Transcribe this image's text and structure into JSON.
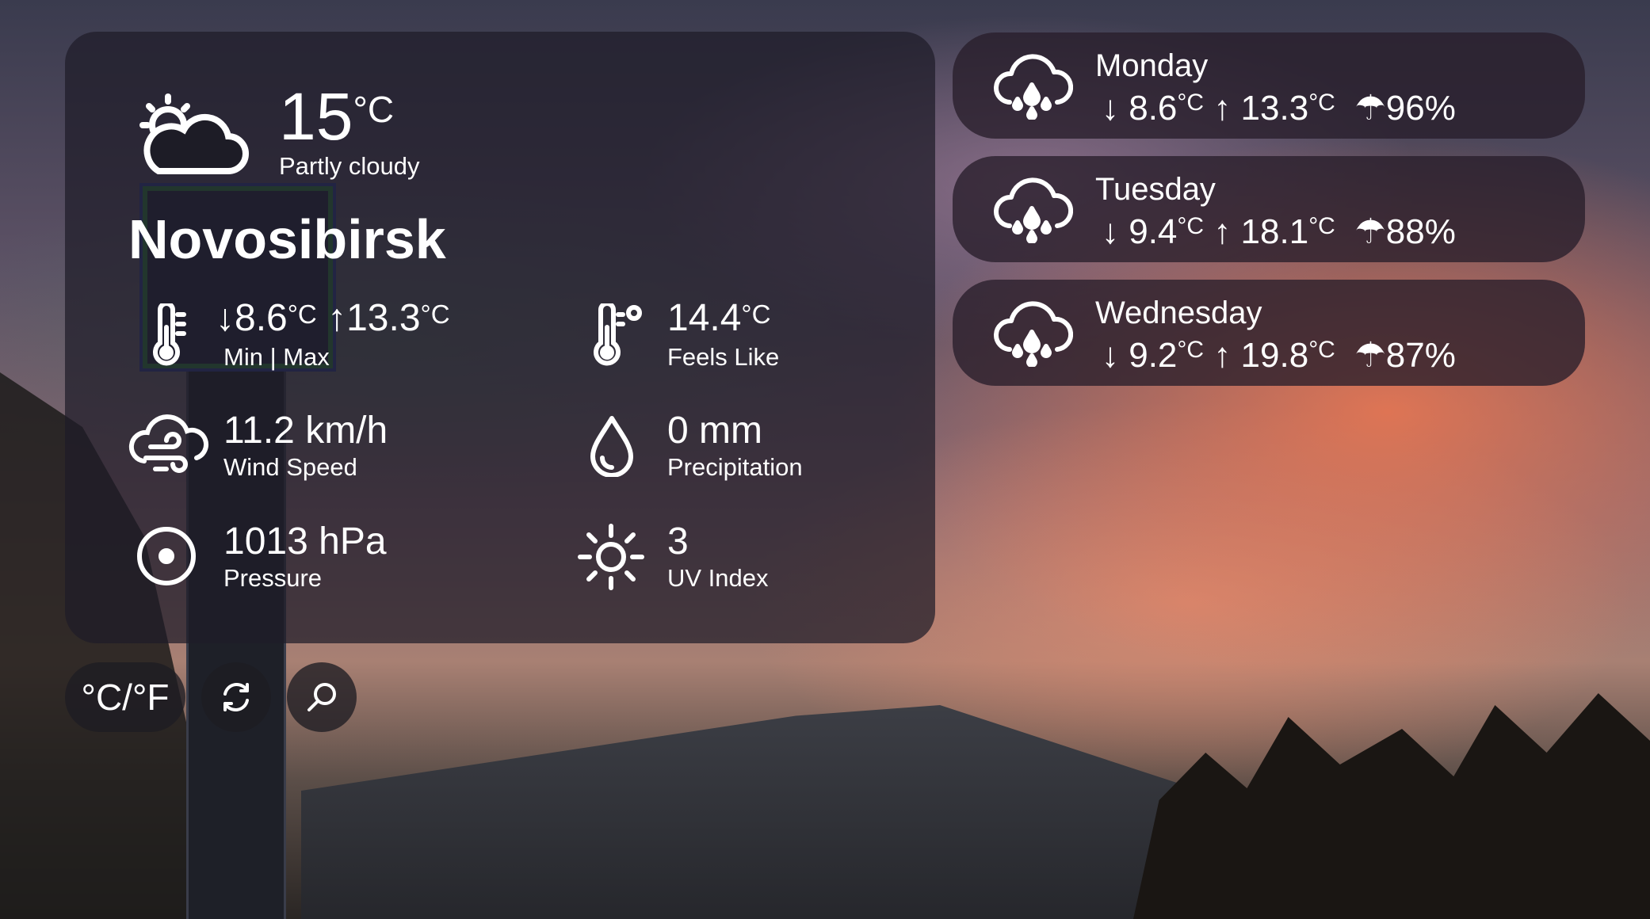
{
  "current": {
    "temperature": "15",
    "temperature_unit": "°C",
    "condition": "Partly cloudy",
    "city": "Novosibirsk"
  },
  "details": {
    "min": "8.6",
    "min_unit": "°C",
    "max": "13.3",
    "max_unit": "°C",
    "minmax_label": "Min | Max",
    "feels_like": "14.4",
    "feels_like_unit": "°C",
    "feels_like_label": "Feels Like",
    "wind": "11.2 km/h",
    "wind_label": "Wind Speed",
    "precipitation": "0 mm",
    "precipitation_label": "Precipitation",
    "pressure": "1013 hPa",
    "pressure_label": "Pressure",
    "uv": "3",
    "uv_label": "UV Index"
  },
  "forecast": [
    {
      "day": "Monday",
      "min": "8.6",
      "max": "13.3",
      "unit": "°C",
      "rain": "96%",
      "icon": "cloud-rain-icon"
    },
    {
      "day": "Tuesday",
      "min": "9.4",
      "max": "18.1",
      "unit": "°C",
      "rain": "88%",
      "icon": "cloud-rain-icon"
    },
    {
      "day": "Wednesday",
      "min": "9.2",
      "max": "19.8",
      "unit": "°C",
      "rain": "87%",
      "icon": "cloud-rain-icon"
    }
  ],
  "controls": {
    "unit_toggle": "°C/°F",
    "refresh_icon": "refresh-icon",
    "search_icon": "search-icon"
  }
}
